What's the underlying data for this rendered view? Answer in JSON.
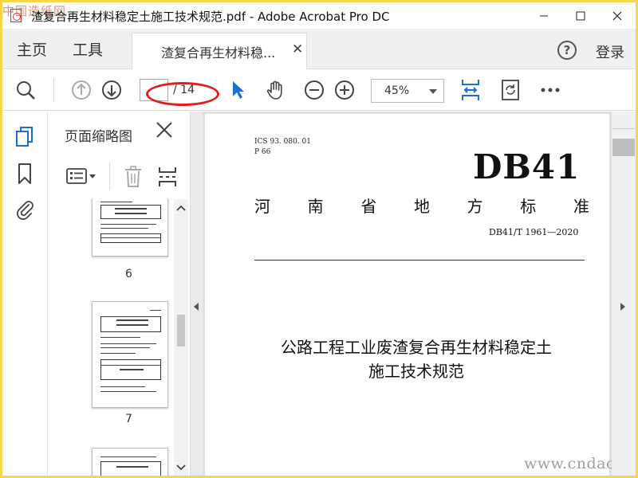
{
  "window": {
    "title": "渣复合再生材料稳定土施工技术规范.pdf - Adobe Acrobat Pro DC",
    "watermark_corner": "中国造纸网"
  },
  "menubar": {
    "home": "主页",
    "tools": "工具",
    "tab_label": "渣复合再生材料稳...",
    "help": "?",
    "login": "登录"
  },
  "toolbar": {
    "page_total": "/ 14",
    "zoom": "45%"
  },
  "thumbnails": {
    "title": "页面缩略图",
    "pages": [
      "6",
      "7"
    ]
  },
  "document": {
    "ics": "ICS   93. 080. 01",
    "p_class": "P  66",
    "code": "DB41",
    "province_chars": [
      "河",
      "南",
      "省",
      "地",
      "方",
      "标",
      "准"
    ],
    "std_no": "DB41/T  1961—2020",
    "title_line1": "公路工程工业废渣复合再生材料稳定土",
    "title_line2": "施工技术规范",
    "watermark_url": "www.cndao.com"
  },
  "colors": {
    "accent_blue": "#1f6fd0",
    "annotation_red": "#e01e1e",
    "frame_yellow": "#f3d84a"
  }
}
